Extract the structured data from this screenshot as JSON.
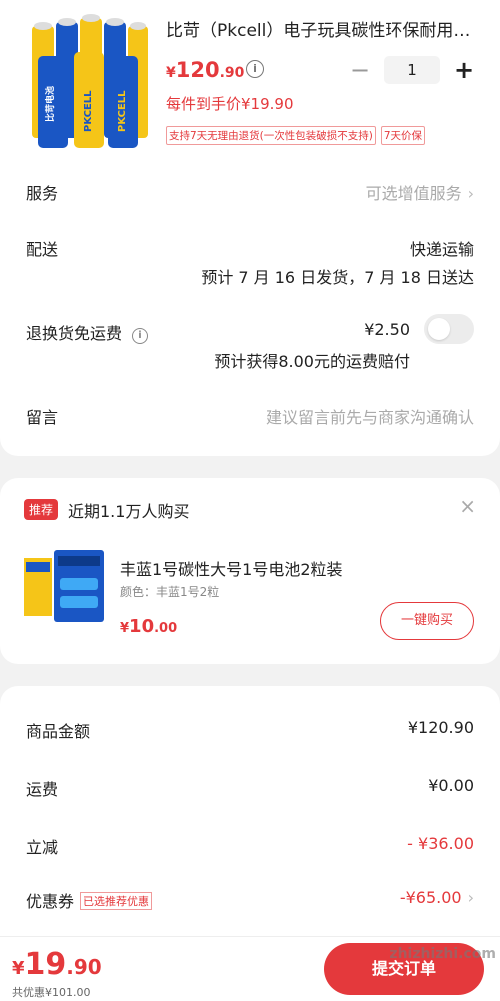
{
  "product": {
    "title": "比苛（Pkcell）电子玩具碳性环保耐用电池",
    "price_symbol": "¥",
    "price_int": "120",
    "price_dec": ".90",
    "quantity": "1",
    "each_price": "每件到手价¥19.90",
    "tags": [
      "支持7天无理由退货(一次性包装破损不支持)",
      "7天价保"
    ],
    "brand_text": "PKCELL",
    "brand_cn": "比苛电池"
  },
  "rows": {
    "service_label": "服务",
    "service_value": "可选增值服务",
    "delivery_label": "配送",
    "delivery_method": "快递运输",
    "delivery_eta": "预计 7 月 16 日发货，7 月 18 日送达",
    "return_label": "退换货免运费",
    "return_price": "¥2.50",
    "return_note": "预计获得8.00元的运费赔付",
    "message_label": "留言",
    "message_placeholder": "建议留言前先与商家沟通确认"
  },
  "recommend": {
    "badge": "推荐",
    "title": "近期1.1万人购买",
    "close": "×",
    "item_name": "丰蓝1号碳性大号1号电池2粒装",
    "item_spec": "颜色：丰蓝1号2粒",
    "price_symbol": "¥",
    "price_int": "10",
    "price_dec": ".00",
    "buy_label": "一键购买"
  },
  "summary": {
    "goods_label": "商品金额",
    "goods_value": "¥120.90",
    "shipping_label": "运费",
    "shipping_value": "¥0.00",
    "reduce_label": "立减",
    "reduce_value": "- ¥36.00",
    "coupon_label": "优惠券",
    "coupon_tag": "已选推荐优惠",
    "coupon_value": "-¥65.00"
  },
  "bottom": {
    "symbol": "¥",
    "total_int": "19",
    "total_dec": ".90",
    "discount": "共优惠¥101.00",
    "submit_label": "提交订单",
    "watermark": "zhizhizhi.com"
  },
  "colors": {
    "accent": "#e4393c",
    "battery_yellow": "#f5c518",
    "battery_blue": "#1a56c4"
  }
}
